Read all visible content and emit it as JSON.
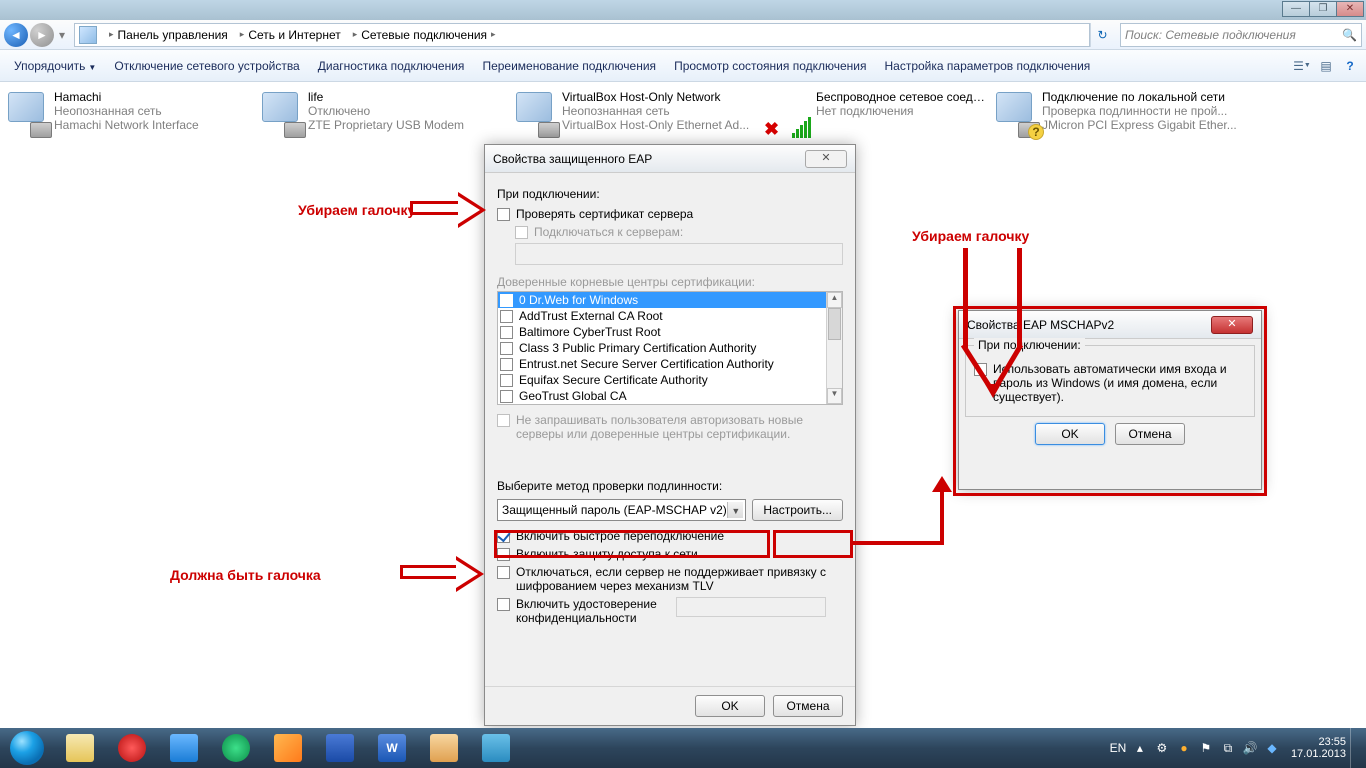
{
  "window_controls": {
    "min": "—",
    "max": "❐",
    "close": "✕"
  },
  "breadcrumbs": [
    "Панель управления",
    "Сеть и Интернет",
    "Сетевые подключения"
  ],
  "search_placeholder": "Поиск: Сетевые подключения",
  "toolbar": {
    "organize": "Упорядочить",
    "disable": "Отключение сетевого устройства",
    "diagnose": "Диагностика подключения",
    "rename": "Переименование подключения",
    "status": "Просмотр состояния подключения",
    "settings": "Настройка параметров подключения"
  },
  "connections": [
    {
      "name": "Hamachi",
      "status": "Неопознанная сеть",
      "device": "Hamachi Network Interface",
      "kind": "net"
    },
    {
      "name": "life",
      "status": "Отключено",
      "device": "ZTE Proprietary USB Modem",
      "kind": "modem"
    },
    {
      "name": "VirtualBox Host-Only Network",
      "status": "Неопознанная сеть",
      "device": "VirtualBox Host-Only Ethernet Ad...",
      "kind": "vbox"
    },
    {
      "name": "Беспроводное сетевое соединение",
      "status": "Нет подключения",
      "device": "",
      "kind": "wifi"
    },
    {
      "name": "Подключение по локальной сети",
      "status": "Проверка подлинности не прой...",
      "device": "JMicron PCI Express Gigabit Ether...",
      "kind": "eth"
    }
  ],
  "eap": {
    "title": "Свойства защищенного EAP",
    "on_connect": "При подключении:",
    "validate_cert": "Проверять сертификат сервера",
    "connect_servers": "Подключаться к серверам:",
    "trusted_ca": "Доверенные корневые центры сертификации:",
    "ca_list": [
      "0 Dr.Web for Windows",
      "AddTrust External CA Root",
      "Baltimore CyberTrust Root",
      "Class 3 Public Primary Certification Authority",
      "Entrust.net Secure Server Certification Authority",
      "Equifax Secure Certificate Authority",
      "GeoTrust Global CA"
    ],
    "no_prompt": "Не запрашивать пользователя авторизовать новые серверы или доверенные центры сертификации.",
    "auth_method_label": "Выберите метод проверки подлинности:",
    "auth_method": "Защищенный пароль (EAP-MSCHAP v2)",
    "configure_btn": "Настроить...",
    "fast_reconnect": "Включить быстрое переподключение",
    "nap": "Включить защиту доступа к сети",
    "disconnect_tlv": "Отключаться, если сервер не поддерживает привязку с шифрованием через механизм TLV",
    "id_privacy": "Включить удостоверение конфиденциальности",
    "ok": "OK",
    "cancel": "Отмена"
  },
  "mschap": {
    "title": "Свойства EAP MSCHAPv2",
    "on_connect": "При подключении:",
    "auto_windows": "Использовать автоматически имя входа и пароль из Windows (и имя домена, если существует).",
    "ok": "OK",
    "cancel": "Отмена"
  },
  "annotations": {
    "remove_check": "Убираем галочку",
    "must_check": "Должна быть галочка"
  },
  "tray": {
    "lang": "EN",
    "time": "23:55",
    "date": "17.01.2013"
  }
}
